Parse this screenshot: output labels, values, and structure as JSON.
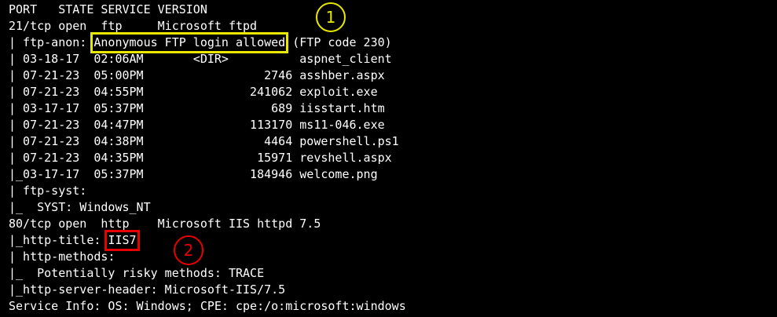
{
  "terminal": {
    "lines": [
      "PORT   STATE SERVICE VERSION",
      "21/tcp open  ftp     Microsoft ftpd",
      {
        "pre": "| ftp-anon: ",
        "hl": "Anonymous FTP login allowed",
        "post": " (FTP code 230)"
      },
      "| 03-18-17  02:06AM       <DIR>          aspnet_client",
      "| 07-21-23  05:00PM                 2746 asshber.aspx",
      "| 07-21-23  04:55PM               241062 exploit.exe",
      "| 03-17-17  05:37PM                  689 iisstart.htm",
      "| 07-21-23  04:47PM               113170 ms11-046.exe",
      "| 07-21-23  04:38PM                 4464 powershell.ps1",
      "| 07-21-23  04:35PM                15971 revshell.aspx",
      "|_03-17-17  05:37PM               184946 welcome.png",
      "| ftp-syst:",
      "|_  SYST: Windows_NT",
      "80/tcp open  http    Microsoft IIS httpd 7.5",
      {
        "pre": "|_http-title: ",
        "hl": "IIS7",
        "post": ""
      },
      "| http-methods:",
      "|_  Potentially risky methods: TRACE",
      "|_http-server-header: Microsoft-IIS/7.5",
      "Service Info: OS: Windows; CPE: cpe:/o:microsoft:windows"
    ]
  },
  "annotations": {
    "marker_1": "1",
    "marker_2": "2"
  },
  "colors": {
    "background": "#000000",
    "text": "#ffffff",
    "highlight_1": "#e8e800",
    "highlight_2": "#e80000"
  }
}
